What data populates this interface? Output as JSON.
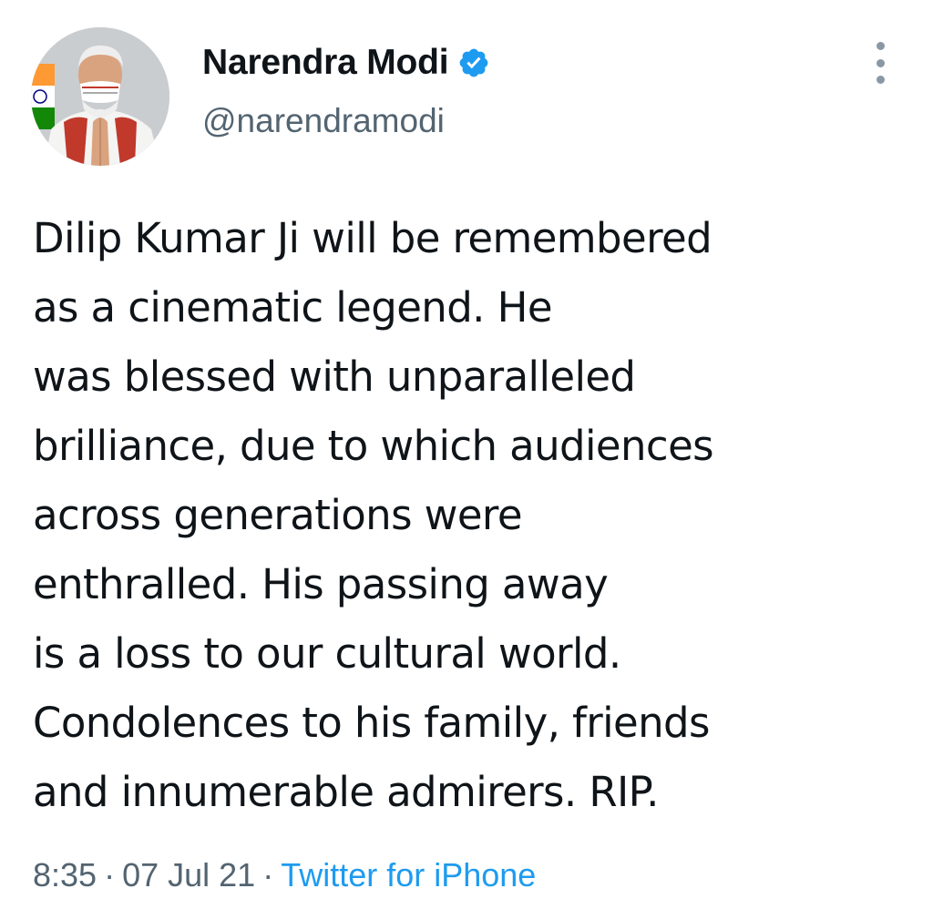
{
  "author": {
    "display_name": "Narendra Modi",
    "handle": "@narendramodi",
    "verified_icon": "verified-badge-icon",
    "avatar_icon": "profile-photo"
  },
  "tweet": {
    "lines": [
      "Dilip Kumar Ji will be remembered",
      "as a cinematic legend. He",
      "was blessed with unparalleled",
      "brilliance, due to which audiences",
      "across generations were",
      "enthralled. His passing away",
      "is a loss to our cultural world.",
      "Condolences to his family, friends",
      "and innumerable admirers. RIP."
    ],
    "time": "8:35",
    "date": "07 Jul 21",
    "separator": "·",
    "source": "Twitter for iPhone"
  },
  "menu": {
    "icon": "more-options-icon"
  },
  "colors": {
    "text": "#0f1419",
    "secondary": "#536471",
    "link": "#1d9bf0",
    "verified": "#1d9bf0"
  }
}
